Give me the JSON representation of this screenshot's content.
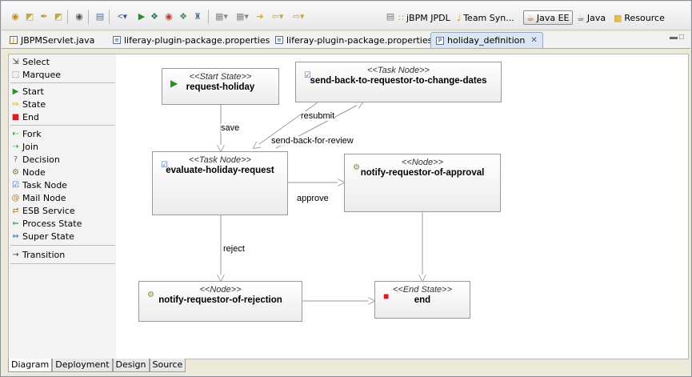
{
  "toolbar": {
    "perspectives": [
      {
        "label": "jBPM JPDL",
        "icon": "jbpm-icon",
        "active": false
      },
      {
        "label": "Team Syn...",
        "icon": "team-sync-icon",
        "active": false
      },
      {
        "label": "Java EE",
        "icon": "java-ee-icon",
        "active": true
      },
      {
        "label": "Java",
        "icon": "java-icon",
        "active": false
      },
      {
        "label": "Resource",
        "icon": "resource-icon",
        "active": false
      }
    ]
  },
  "editor_tabs": [
    {
      "label": "JBPMServlet.java",
      "icon": "java-file-icon",
      "active": false
    },
    {
      "label": "liferay-plugin-package.properties",
      "icon": "properties-file-icon",
      "active": false
    },
    {
      "label": "liferay-plugin-package.properties",
      "icon": "properties-file-icon",
      "active": false
    },
    {
      "label": "holiday_definition",
      "icon": "process-definition-icon",
      "active": true
    }
  ],
  "palette": {
    "tools": [
      {
        "label": "Select",
        "icon": "select-arrow-icon"
      },
      {
        "label": "Marquee",
        "icon": "marquee-icon"
      }
    ],
    "nodes": [
      {
        "label": "Start",
        "icon": "start-icon"
      },
      {
        "label": "State",
        "icon": "state-icon"
      },
      {
        "label": "End",
        "icon": "end-icon"
      },
      {
        "label": "Fork",
        "icon": "fork-icon"
      },
      {
        "label": "Join",
        "icon": "join-icon"
      },
      {
        "label": "Decision",
        "icon": "decision-icon"
      },
      {
        "label": "Node",
        "icon": "node-icon"
      },
      {
        "label": "Task Node",
        "icon": "task-node-icon"
      },
      {
        "label": "Mail Node",
        "icon": "mail-node-icon"
      },
      {
        "label": "ESB Service",
        "icon": "esb-service-icon"
      },
      {
        "label": "Process State",
        "icon": "process-state-icon"
      },
      {
        "label": "Super State",
        "icon": "super-state-icon"
      }
    ],
    "connections": [
      {
        "label": "Transition",
        "icon": "transition-arrow-icon"
      }
    ]
  },
  "diagram": {
    "nodes": [
      {
        "stereotype": "<<Start State>>",
        "name": "request-holiday",
        "icon": "start-state-icon"
      },
      {
        "stereotype": "<<Task Node>>",
        "name": "send-back-to-requestor-to-change-dates",
        "icon": "task-node-icon"
      },
      {
        "stereotype": "<<Task Node>>",
        "name": "evaluate-holiday-request",
        "icon": "task-node-icon"
      },
      {
        "stereotype": "<<Node>>",
        "name": "notify-requestor-of-approval",
        "icon": "node-gear-icon"
      },
      {
        "stereotype": "<<Node>>",
        "name": "notify-requestor-of-rejection",
        "icon": "node-gear-icon"
      },
      {
        "stereotype": "<<End State>>",
        "name": "end",
        "icon": "end-state-icon"
      }
    ],
    "transitions": [
      {
        "label": "save"
      },
      {
        "label": "resubmit"
      },
      {
        "label": "send-back-for-review"
      },
      {
        "label": "approve"
      },
      {
        "label": "reject"
      }
    ]
  },
  "bottom_tabs": [
    {
      "label": "Diagram",
      "active": true
    },
    {
      "label": "Deployment",
      "active": false
    },
    {
      "label": "Design",
      "active": false
    },
    {
      "label": "Source",
      "active": false
    }
  ],
  "colors": {
    "start": "#2e8b2e",
    "end": "#d42020",
    "task_icon": "#3a6bb0",
    "node_gear": "#7a8a3a",
    "active_tab": "#dbe6f4"
  }
}
